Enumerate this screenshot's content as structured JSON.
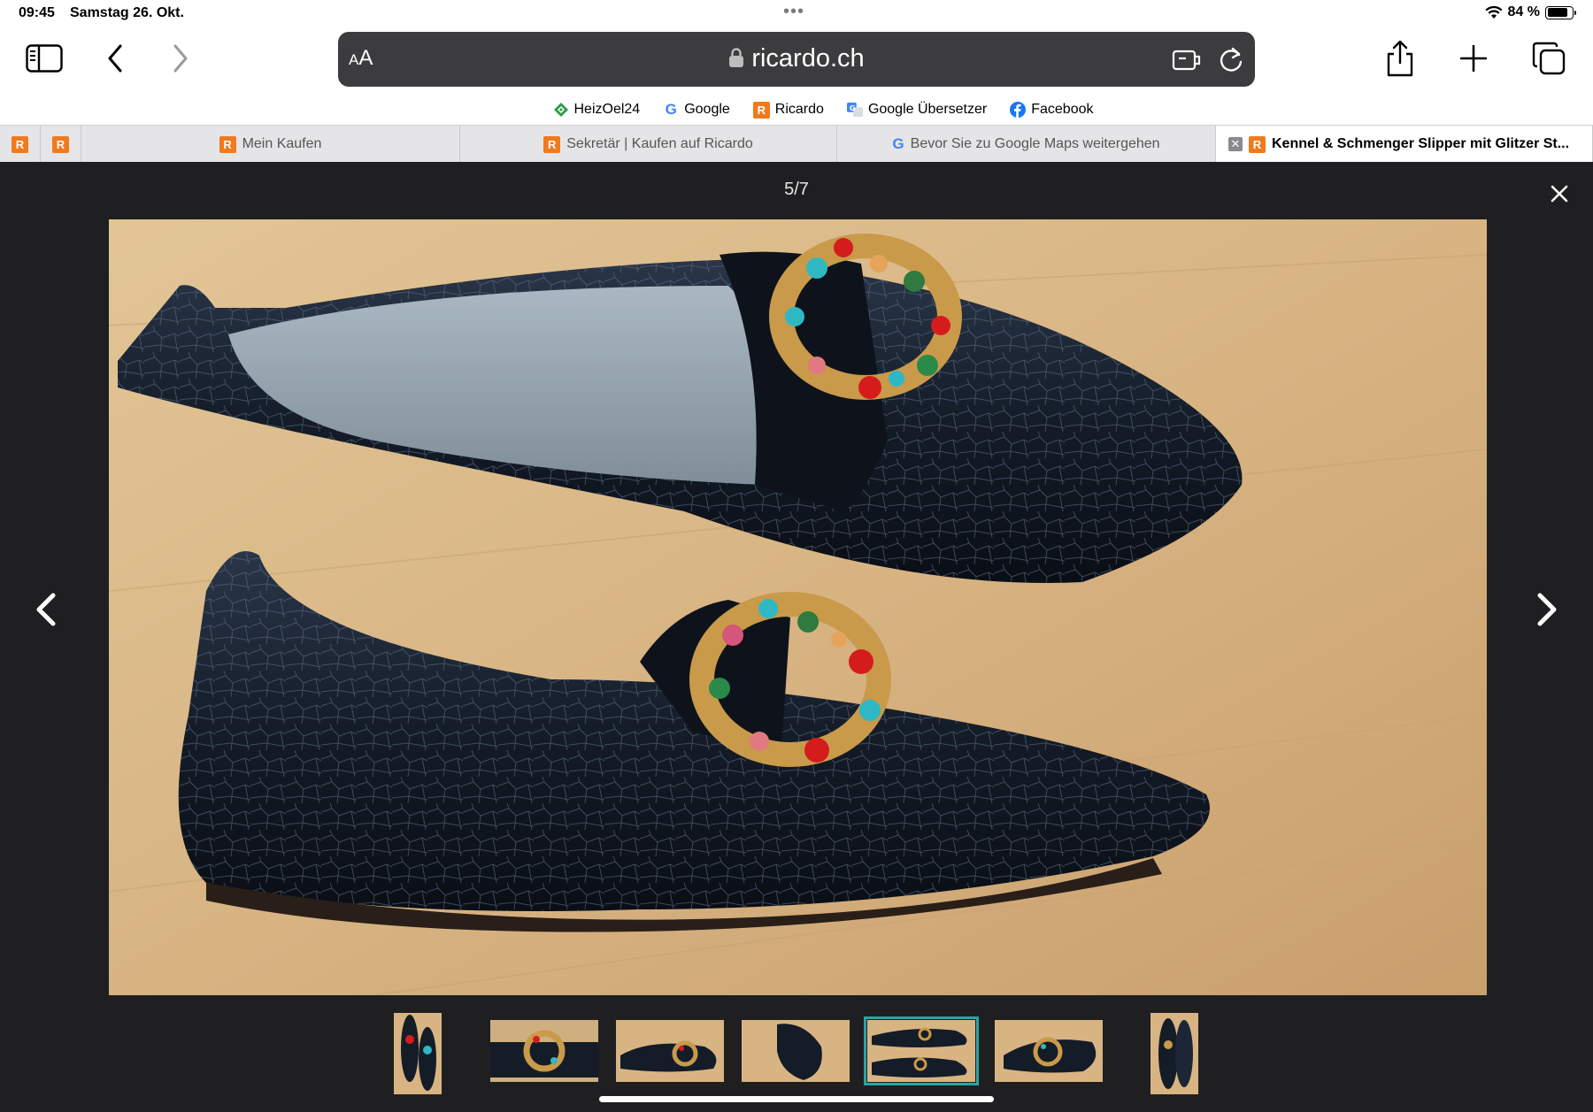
{
  "status": {
    "time": "09:45",
    "date": "Samstag 26. Okt.",
    "battery": "84 %",
    "battery_level": 0.84
  },
  "toolbar": {
    "aa_label": "AA",
    "url": "ricardo.ch"
  },
  "favorites": [
    {
      "label": "HeizOel24",
      "icon": "heizoel-icon"
    },
    {
      "label": "Google",
      "icon": "google-icon"
    },
    {
      "label": "Ricardo",
      "icon": "ricardo-icon"
    },
    {
      "label": "Google Übersetzer",
      "icon": "translate-icon"
    },
    {
      "label": "Facebook",
      "icon": "facebook-icon"
    }
  ],
  "tabs": [
    {
      "label": "Mein Kaufen"
    },
    {
      "label": "Sekretär | Kaufen auf Ricardo"
    },
    {
      "label": "Bevor Sie zu Google Maps weitergehen"
    },
    {
      "label": "Kennel & Schmenger Slipper mit Glitzer St..."
    }
  ],
  "gallery": {
    "counter": "5/7",
    "current": 5,
    "total": 7
  },
  "colors": {
    "url_bar": "#3c3c3e",
    "gallery_bg": "#1f1f21",
    "active_thumb_border": "#2aa3a3",
    "ricardo_orange": "#f07a1e"
  }
}
